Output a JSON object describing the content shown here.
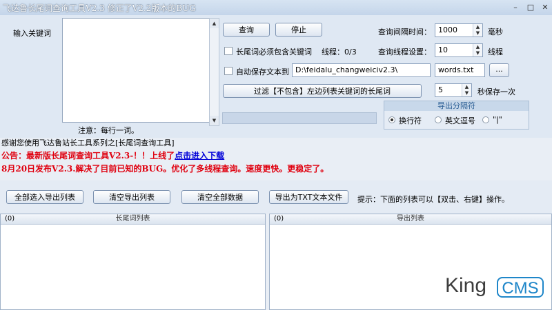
{
  "window": {
    "title": "飞达鲁长尾词查询工具V2.3 修正了V2.2版本的BUG",
    "min_glyph": "–",
    "max_glyph": "□",
    "close_glyph": "✕"
  },
  "input": {
    "label": "输入关键词",
    "note": "注意：每行一词。",
    "scroll_up": "▲",
    "scroll_down": "▼"
  },
  "buttons": {
    "query": "查询",
    "stop": "停止",
    "browse": "...",
    "filter": "过滤【不包含】左边列表关键词的长尾词"
  },
  "options": {
    "must_contain_label": "长尾词必须包含关键词",
    "must_contain_checked": false,
    "thread_status": "线程：0/3",
    "autosave_label": "自动保存文本到",
    "autosave_checked": false,
    "autosave_path": "D:\\feidalu_changweiciv2.3\\",
    "autosave_file": "words.txt",
    "interval_label": "查询间隔时间：",
    "interval_value": "1000",
    "interval_unit": "毫秒",
    "threads_label": "查询线程设置：",
    "threads_value": "10",
    "threads_unit": "线程",
    "save_every_value": "5",
    "save_every_label": "秒保存一次",
    "spin_up": "▲",
    "spin_down": "▼"
  },
  "separator": {
    "title": "导出分隔符",
    "options": [
      {
        "label": "换行符",
        "selected": true
      },
      {
        "label": "英文逗号",
        "selected": false
      },
      {
        "label": "\"|\"",
        "selected": false
      }
    ]
  },
  "messages": {
    "thanks": "感谢您使用飞达鲁站长工具系列之[长尾词查询工具]",
    "announce_text": "公告：最新版长尾词查询工具V2.3-！！上线了",
    "announce_link": "点击进入下载",
    "release_note": "8月20日发布V2.3.解决了目前已知的BUG。优化了多线程查询。速度更快。更稳定了。"
  },
  "toolbar": {
    "select_all": "全部选入导出列表",
    "clear_export": "清空导出列表",
    "clear_all": "清空全部数据",
    "export_txt": "导出为TXT文本文件",
    "hint": "提示：下面的列表可以【双击、右键】操作。"
  },
  "lists": {
    "left": {
      "count": "(0)",
      "title": "长尾词列表"
    },
    "right": {
      "count": "(0)",
      "title": "导出列表"
    }
  },
  "watermark": {
    "king": "King",
    "cms": "CMS"
  }
}
